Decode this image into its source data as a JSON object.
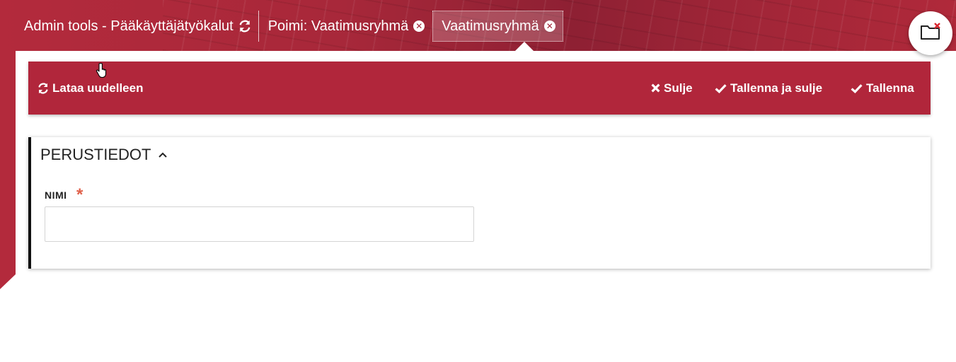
{
  "tabs": [
    {
      "label": "Admin tools - Pääkäyttäjätyökalut",
      "icon": "refresh-icon"
    },
    {
      "label": "Poimi: Vaatimusryhmä",
      "icon": "close-circle-icon"
    },
    {
      "label": "Vaatimusryhmä",
      "icon": "close-circle-icon",
      "active": true
    }
  ],
  "toolbar": {
    "reload_label": "Lataa uudelleen",
    "close_label": "Sulje",
    "save_close_label": "Tallenna ja sulje",
    "save_label": "Tallenna"
  },
  "section": {
    "title": "PERUSTIEDOT",
    "expanded": true
  },
  "form": {
    "name_label": "NIMI",
    "name_required_mark": "*",
    "name_value": ""
  },
  "fab": {
    "icon": "folder-close-icon"
  },
  "colors": {
    "brand": "#b1263b",
    "required": "#e0604a"
  }
}
